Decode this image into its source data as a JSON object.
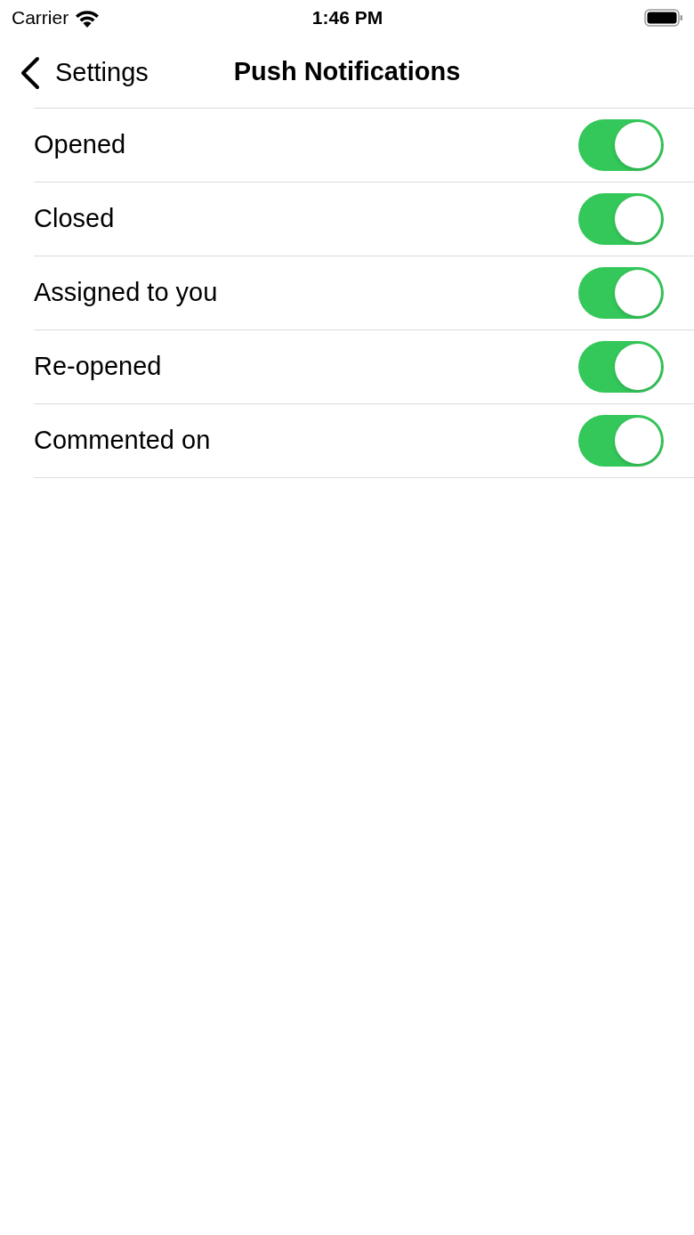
{
  "status_bar": {
    "carrier": "Carrier",
    "time": "1:46 PM"
  },
  "nav_bar": {
    "back_label": "Settings",
    "title": "Push Notifications"
  },
  "settings": [
    {
      "label": "Opened",
      "on": true
    },
    {
      "label": "Closed",
      "on": true
    },
    {
      "label": "Assigned to you",
      "on": true
    },
    {
      "label": "Re-opened",
      "on": true
    },
    {
      "label": "Commented on",
      "on": true
    }
  ]
}
